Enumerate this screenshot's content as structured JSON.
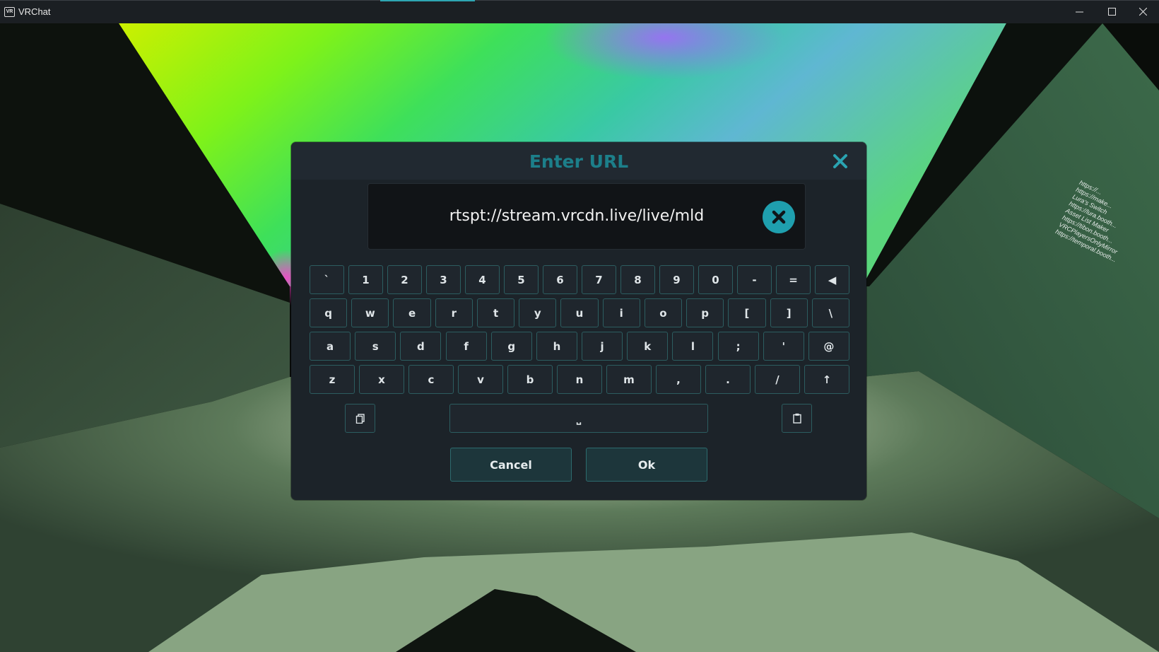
{
  "window": {
    "title": "VRChat",
    "app_icon": "vrchat-icon",
    "buttons": [
      "minimize-icon",
      "maximize-icon",
      "close-icon"
    ]
  },
  "dialog": {
    "title": "Enter URL",
    "url_value": "rtspt://stream.vrcdn.live/live/mld",
    "close_icon": "close-icon",
    "clear_icon": "clear-circle-icon",
    "title_color": "#1c7f8a",
    "accent_color": "#1f9fae"
  },
  "keyboard": {
    "row1": [
      "`",
      "1",
      "2",
      "3",
      "4",
      "5",
      "6",
      "7",
      "8",
      "9",
      "0",
      "-",
      "=",
      "◀"
    ],
    "row2": [
      "q",
      "w",
      "e",
      "r",
      "t",
      "y",
      "u",
      "i",
      "o",
      "p",
      "[",
      "]",
      "\\"
    ],
    "row3": [
      "a",
      "s",
      "d",
      "f",
      "g",
      "h",
      "j",
      "k",
      "l",
      ";",
      "'",
      "@"
    ],
    "row4": [
      "z",
      "x",
      "c",
      "v",
      "b",
      "n",
      "m",
      ",",
      ".",
      "/",
      "↑"
    ],
    "space_label": "⎵",
    "copy_icon": "copy-icon",
    "paste_icon": "paste-icon"
  },
  "actions": {
    "cancel_label": "Cancel",
    "ok_label": "Ok"
  }
}
